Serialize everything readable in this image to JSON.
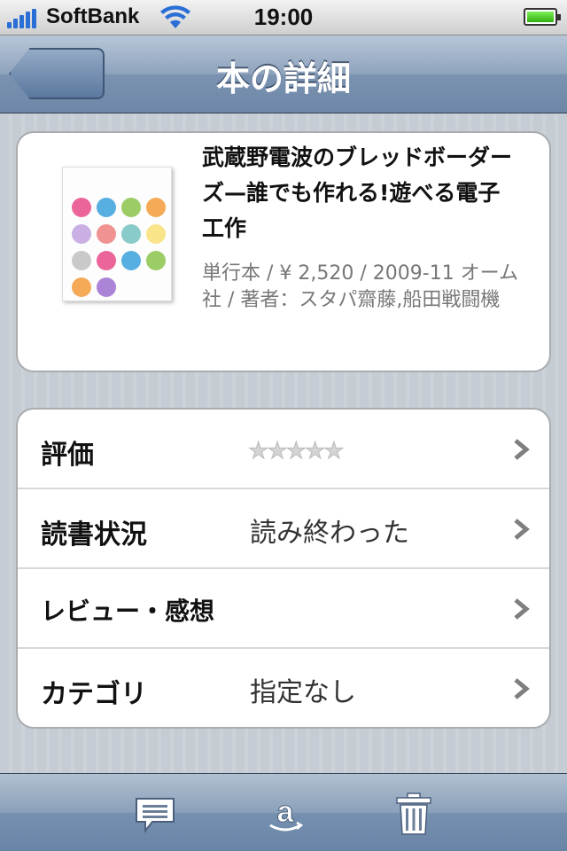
{
  "status": {
    "carrier": "SoftBank",
    "time": "19:00"
  },
  "nav": {
    "title": "本の詳細"
  },
  "book": {
    "title": "武蔵野電波のブレッドボーダーズ—誰でも作れる!遊べる電子工作",
    "meta": "単行本 / ¥ 2,520 / 2009-11 オーム社 / 著者：スタパ齋藤,船田戦闘機",
    "cover_colors": [
      "#e84a8a",
      "#3aa0dc",
      "#8bc34a",
      "#f29b3a",
      "#9e6fd0",
      "#e53a3a",
      "#2aa1a0",
      "#f5d02a",
      "#c0c0c0"
    ]
  },
  "rows": [
    {
      "label": "評価",
      "value": "",
      "rating": 0,
      "rating_max": 5
    },
    {
      "label": "読書状況",
      "value": "読み終わった"
    },
    {
      "label": "レビュー・感想",
      "value": ""
    },
    {
      "label": "カテゴリ",
      "value": "指定なし"
    }
  ],
  "toolbar": {
    "icons": [
      "comment-icon",
      "amazon-icon",
      "trash-icon"
    ]
  },
  "colors": {
    "nav_accent": "#6d87a7",
    "card_bg": "#ffffff",
    "meta_text": "#777777"
  }
}
